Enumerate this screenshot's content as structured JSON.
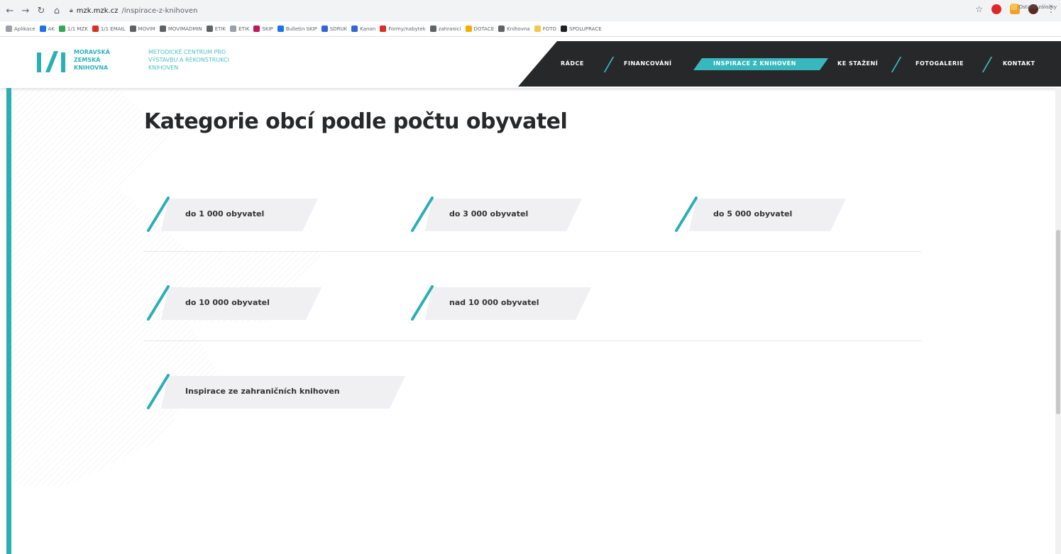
{
  "browser": {
    "url_host": "mzk.mzk.cz",
    "url_path": "/inspirace-z-knihoven"
  },
  "bookmarks": [
    "Aplikace",
    "AK",
    "1/1 MZK",
    "1/1 EMAIL",
    "MOVIM",
    "MOVIMADMIN",
    "ETIK",
    "ETIK",
    "SKIP",
    "Bulletin SKIP",
    "SDRUK",
    "Kanon",
    "Formy/nabytek",
    "zahranici",
    "DOTACE",
    "Knihovna",
    "FOTO",
    "SPOLUPRACE"
  ],
  "bookmarks_last": "Ostatní záložky",
  "header": {
    "logo_lines": [
      "MORAVSKÁ",
      "ZEMSKÁ",
      "KNIHOVNA"
    ],
    "tagline_lines": [
      "METODICKÉ CENTRUM PRO",
      "VÝSTAVBU A REKONSTRUKCI",
      "KNIHOVEN"
    ],
    "nav": [
      "RÁDCE",
      "FINANCOVÁNÍ",
      "INSPIRACE Z KNIHOVEN",
      "KE STAŽENÍ",
      "FOTOGALERIE",
      "KONTAKT"
    ],
    "active_nav": "INSPIRACE Z KNIHOVEN"
  },
  "page": {
    "title": "Kategorie obcí podle počtu obyvatel",
    "categories": [
      "do 1 000 obyvatel",
      "do 3 000 obyvatel",
      "do 5 000 obyvatel",
      "do 10 000 obyvatel",
      "nad 10 000 obyvatel",
      "Inspirace ze zahraničních knihoven"
    ]
  },
  "colors": {
    "accent": "#2aafb5",
    "nav_bg": "#26282a",
    "card_bg": "#f0eff1",
    "title": "#26282a"
  }
}
